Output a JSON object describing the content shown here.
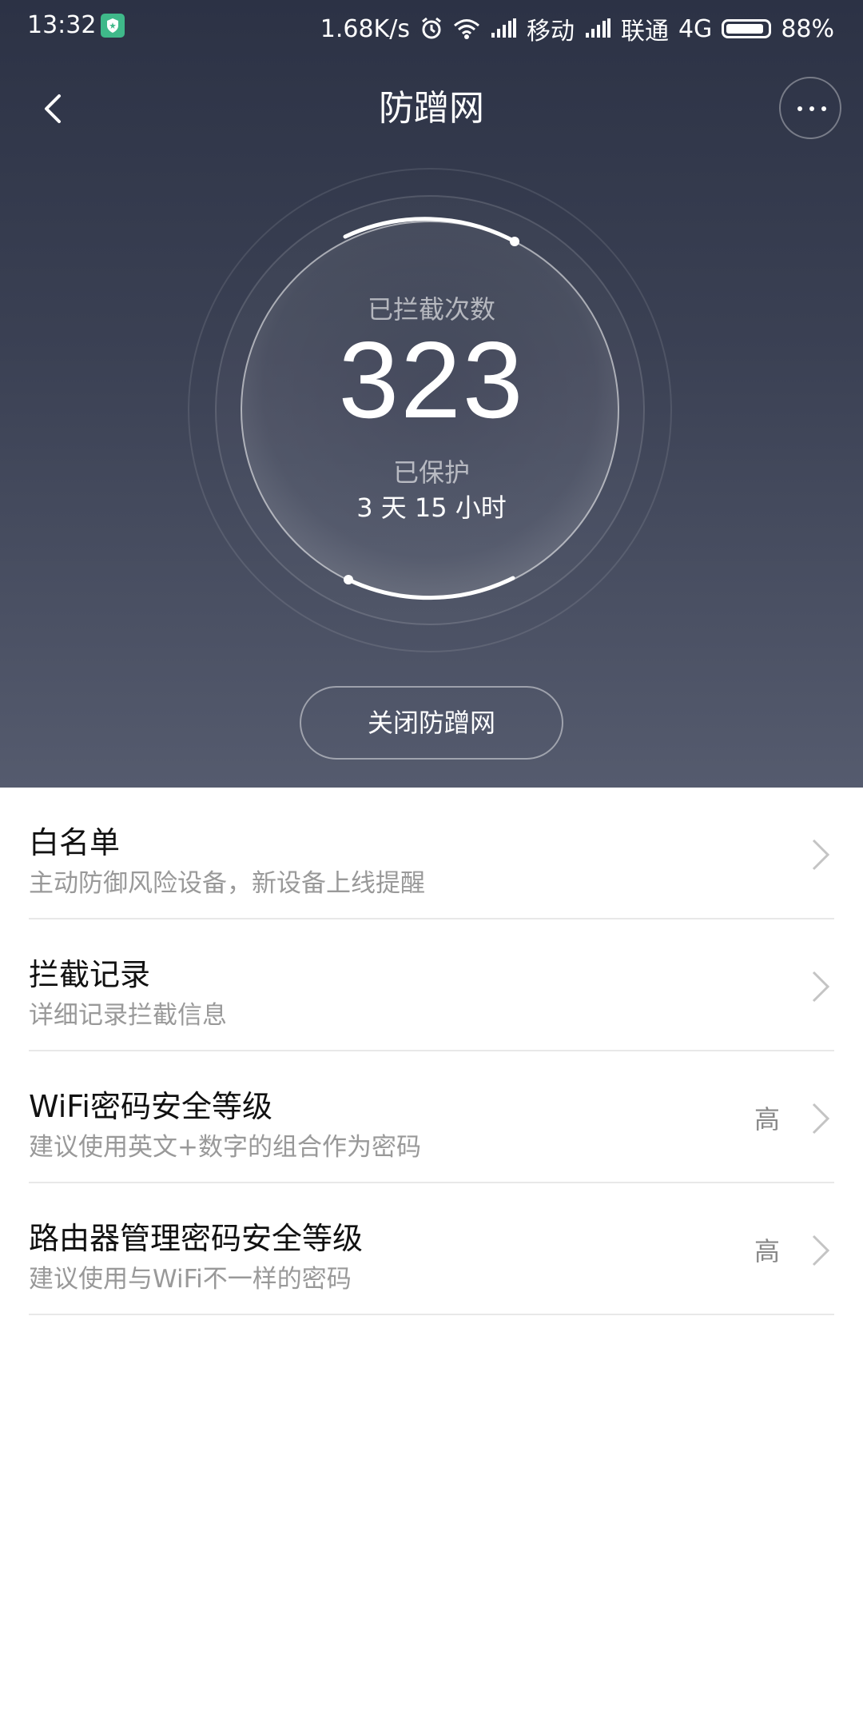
{
  "status_bar": {
    "time": "13:32",
    "speed": "1.68K/s",
    "carrier1": "移动",
    "carrier2": "联通",
    "network": "4G",
    "battery": "88%",
    "icons": [
      "shield-icon",
      "alarm-icon",
      "wifi-icon",
      "signal-icon",
      "battery-icon"
    ]
  },
  "header": {
    "title": "防蹭网",
    "back_icon": "chevron-left-icon",
    "more_icon": "more-dots-icon"
  },
  "stats": {
    "count_label": "已拦截次数",
    "count_value": "323",
    "protect_label": "已保护",
    "protect_value": "3 天 15 小时"
  },
  "actions": {
    "close_label": "关闭防蹭网"
  },
  "list": [
    {
      "title": "白名单",
      "subtitle": "主动防御风险设备，新设备上线提醒",
      "value": ""
    },
    {
      "title": "拦截记录",
      "subtitle": "详细记录拦截信息",
      "value": ""
    },
    {
      "title": "WiFi密码安全等级",
      "subtitle": "建议使用英文+数字的组合作为密码",
      "value": "高"
    },
    {
      "title": "路由器管理密码安全等级",
      "subtitle": "建议使用与WiFi不一样的密码",
      "value": "高"
    }
  ],
  "colors": {
    "header_top": "#2c3245",
    "header_bottom": "#555b6e",
    "title_text": "#111111",
    "subtitle_text": "#999999"
  }
}
